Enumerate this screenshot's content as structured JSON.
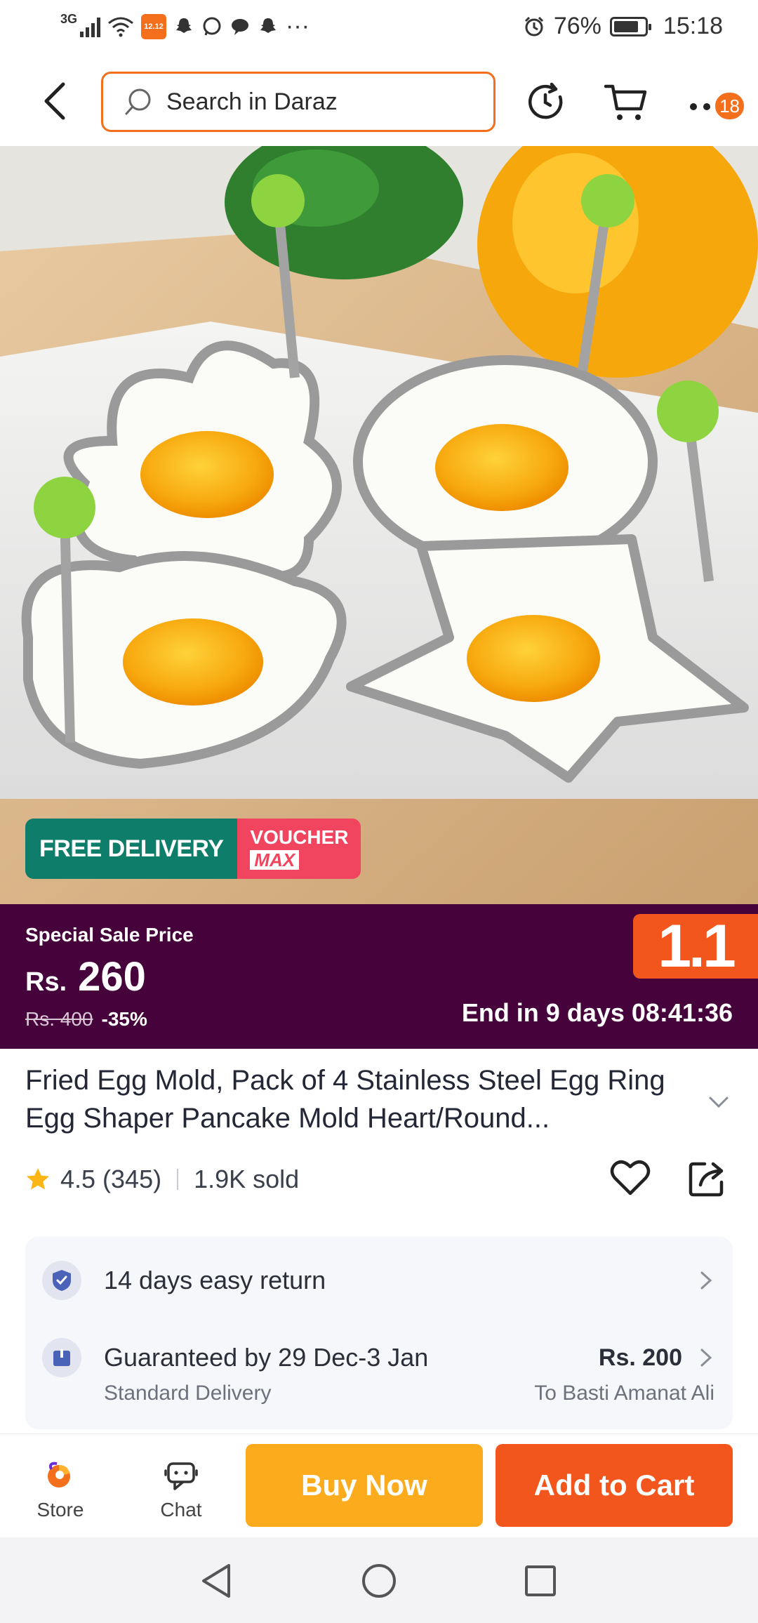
{
  "status_bar": {
    "network": "3G",
    "battery": "76%",
    "time": "15:18",
    "more": "···",
    "app_badge": "12.12"
  },
  "nav": {
    "search_placeholder": "Search in Daraz",
    "more_badge": "18"
  },
  "promo": {
    "free_delivery": "FREE DELIVERY",
    "voucher_line1": "VOUCHER",
    "voucher_line2": "MAX"
  },
  "sale": {
    "label": "Special Sale Price",
    "currency": "Rs.",
    "price": "260",
    "original_price": "Rs. 400",
    "discount": "-35%",
    "ends": "End in 9 days 08:41:36",
    "campaign_badge": "1.1"
  },
  "product": {
    "title": "Fried Egg Mold, Pack of 4 Stainless Steel Egg Ring Egg Shaper Pancake Mold Heart/Round...",
    "rating": "4.5 (345)",
    "sold": "1.9K sold"
  },
  "delivery": {
    "returns": "14 days easy return",
    "guarantee": "Guaranteed by 29 Dec-3 Jan",
    "fee": "Rs. 200",
    "method": "Standard Delivery",
    "destination": "To Basti Amanat Ali"
  },
  "actions": {
    "store": "Store",
    "chat": "Chat",
    "buy_now": "Buy Now",
    "add_to_cart": "Add to Cart"
  },
  "colors": {
    "brand_orange": "#f36f1c",
    "sale_band": "#46023a",
    "buy_now": "#fcab1c",
    "add_to_cart": "#f3561c",
    "free_delivery": "#0e7d6a",
    "voucher": "#f1455f"
  },
  "icons": {
    "back": "chevron-left-icon",
    "search": "search-icon",
    "history": "refresh-icon",
    "cart": "cart-icon",
    "more": "more-icon",
    "star": "star-icon",
    "wishlist": "heart-icon",
    "share": "share-icon",
    "returns": "shield-check-icon",
    "delivery": "truck-icon",
    "store": "store-icon",
    "chat": "chat-icon"
  }
}
